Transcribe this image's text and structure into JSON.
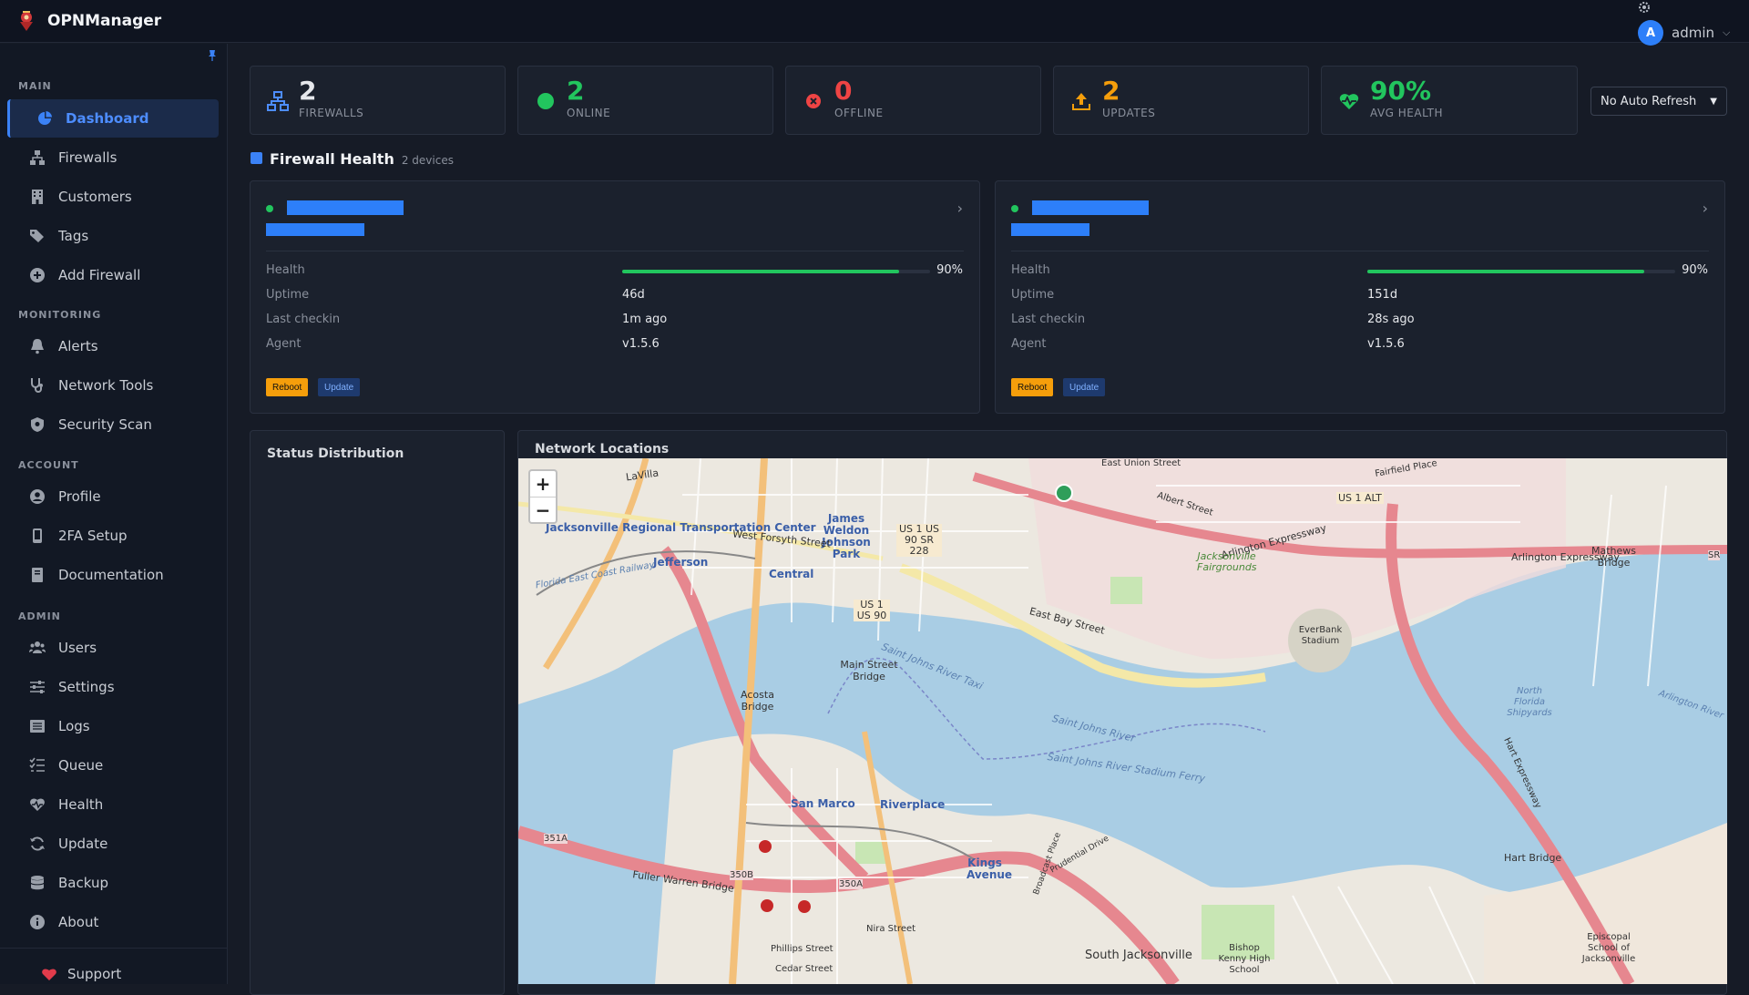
{
  "app": {
    "title": "OPNManager"
  },
  "user": {
    "initial": "A",
    "name": "admin"
  },
  "sidebar": {
    "sections": {
      "main": "MAIN",
      "monitoring": "MONITORING",
      "account": "ACCOUNT",
      "admin": "ADMIN"
    },
    "items": [
      {
        "label": "Dashboard",
        "icon": "dashboard-icon"
      },
      {
        "label": "Firewalls",
        "icon": "network-icon"
      },
      {
        "label": "Customers",
        "icon": "building-icon"
      },
      {
        "label": "Tags",
        "icon": "tags-icon"
      },
      {
        "label": "Add Firewall",
        "icon": "plus-circle-icon"
      },
      {
        "label": "Alerts",
        "icon": "bell-icon"
      },
      {
        "label": "Network Tools",
        "icon": "stethoscope-icon"
      },
      {
        "label": "Security Scan",
        "icon": "shield-icon"
      },
      {
        "label": "Profile",
        "icon": "user-circle-icon"
      },
      {
        "label": "2FA Setup",
        "icon": "mobile-icon"
      },
      {
        "label": "Documentation",
        "icon": "book-icon"
      },
      {
        "label": "Users",
        "icon": "users-icon"
      },
      {
        "label": "Settings",
        "icon": "sliders-icon"
      },
      {
        "label": "Logs",
        "icon": "list-icon"
      },
      {
        "label": "Queue",
        "icon": "tasks-icon"
      },
      {
        "label": "Health",
        "icon": "heartbeat-icon"
      },
      {
        "label": "Update",
        "icon": "sync-icon"
      },
      {
        "label": "Backup",
        "icon": "database-icon"
      },
      {
        "label": "About",
        "icon": "info-icon"
      }
    ],
    "support": "Support"
  },
  "stats": [
    {
      "value": "2",
      "label": "FIREWALLS",
      "color": "#e6e8ec",
      "icon": "network-icon"
    },
    {
      "value": "2",
      "label": "ONLINE",
      "color": "#22c55e",
      "icon": "online-dot-icon"
    },
    {
      "value": "0",
      "label": "OFFLINE",
      "color": "#ef4444",
      "icon": "offline-x-icon"
    },
    {
      "value": "2",
      "label": "UPDATES",
      "color": "#f59e0b",
      "icon": "upload-icon"
    },
    {
      "value": "90%",
      "label": "AVG HEALTH",
      "color": "#22c55e",
      "icon": "heartbeat-icon"
    }
  ],
  "refresh": {
    "selected": "No Auto Refresh"
  },
  "firewall_health": {
    "title": "Firewall Health",
    "subtitle": "2 devices",
    "labels": {
      "health": "Health",
      "uptime": "Uptime",
      "last_checkin": "Last checkin",
      "agent": "Agent"
    },
    "buttons": {
      "reboot": "Reboot",
      "update": "Update"
    },
    "devices": [
      {
        "health_pct": 90,
        "health_text": "90%",
        "uptime": "46d",
        "last_checkin": "1m ago",
        "agent": "v1.5.6"
      },
      {
        "health_pct": 90,
        "health_text": "90%",
        "uptime": "151d",
        "last_checkin": "28s ago",
        "agent": "v1.5.6"
      }
    ]
  },
  "status_distribution": {
    "title": "Status Distribution"
  },
  "network_locations": {
    "title": "Network Locations",
    "zoom_in": "+",
    "zoom_out": "−",
    "labels": [
      "Jacksonville Regional Transportation Center",
      "Jefferson",
      "Central",
      "James Weldon Johnson Park",
      "West Forsyth Street",
      "US 1 US 90 SR 228",
      "US 1 US 90",
      "Main Street Bridge",
      "Acosta Bridge",
      "Saint Johns River Taxi",
      "Saint Johns River",
      "Saint Johns River Stadium Ferry",
      "East Bay Street",
      "Arlington Expressway",
      "Jacksonville Fairgrounds",
      "EverBank Stadium",
      "Mathews Bridge",
      "US 1 ALT",
      "North Florida Shipyards",
      "San Marco",
      "Riverplace",
      "Kings Avenue",
      "Hart Bridge",
      "South Jacksonville",
      "Bishop Kenny High School",
      "Episcopal School of Jacksonville",
      "Fuller Warren Bridge",
      "Florida East Coast Railway",
      "LaVilla",
      "Albert Street",
      "East Union Street",
      "Fairfield Place",
      "350B",
      "350A",
      "351A",
      "Nira Street",
      "Phillips Street",
      "Cedar Street",
      "Arlington River",
      "Hart Expressway",
      "Prudential Drive",
      "Broadcast Place",
      "SR"
    ]
  }
}
